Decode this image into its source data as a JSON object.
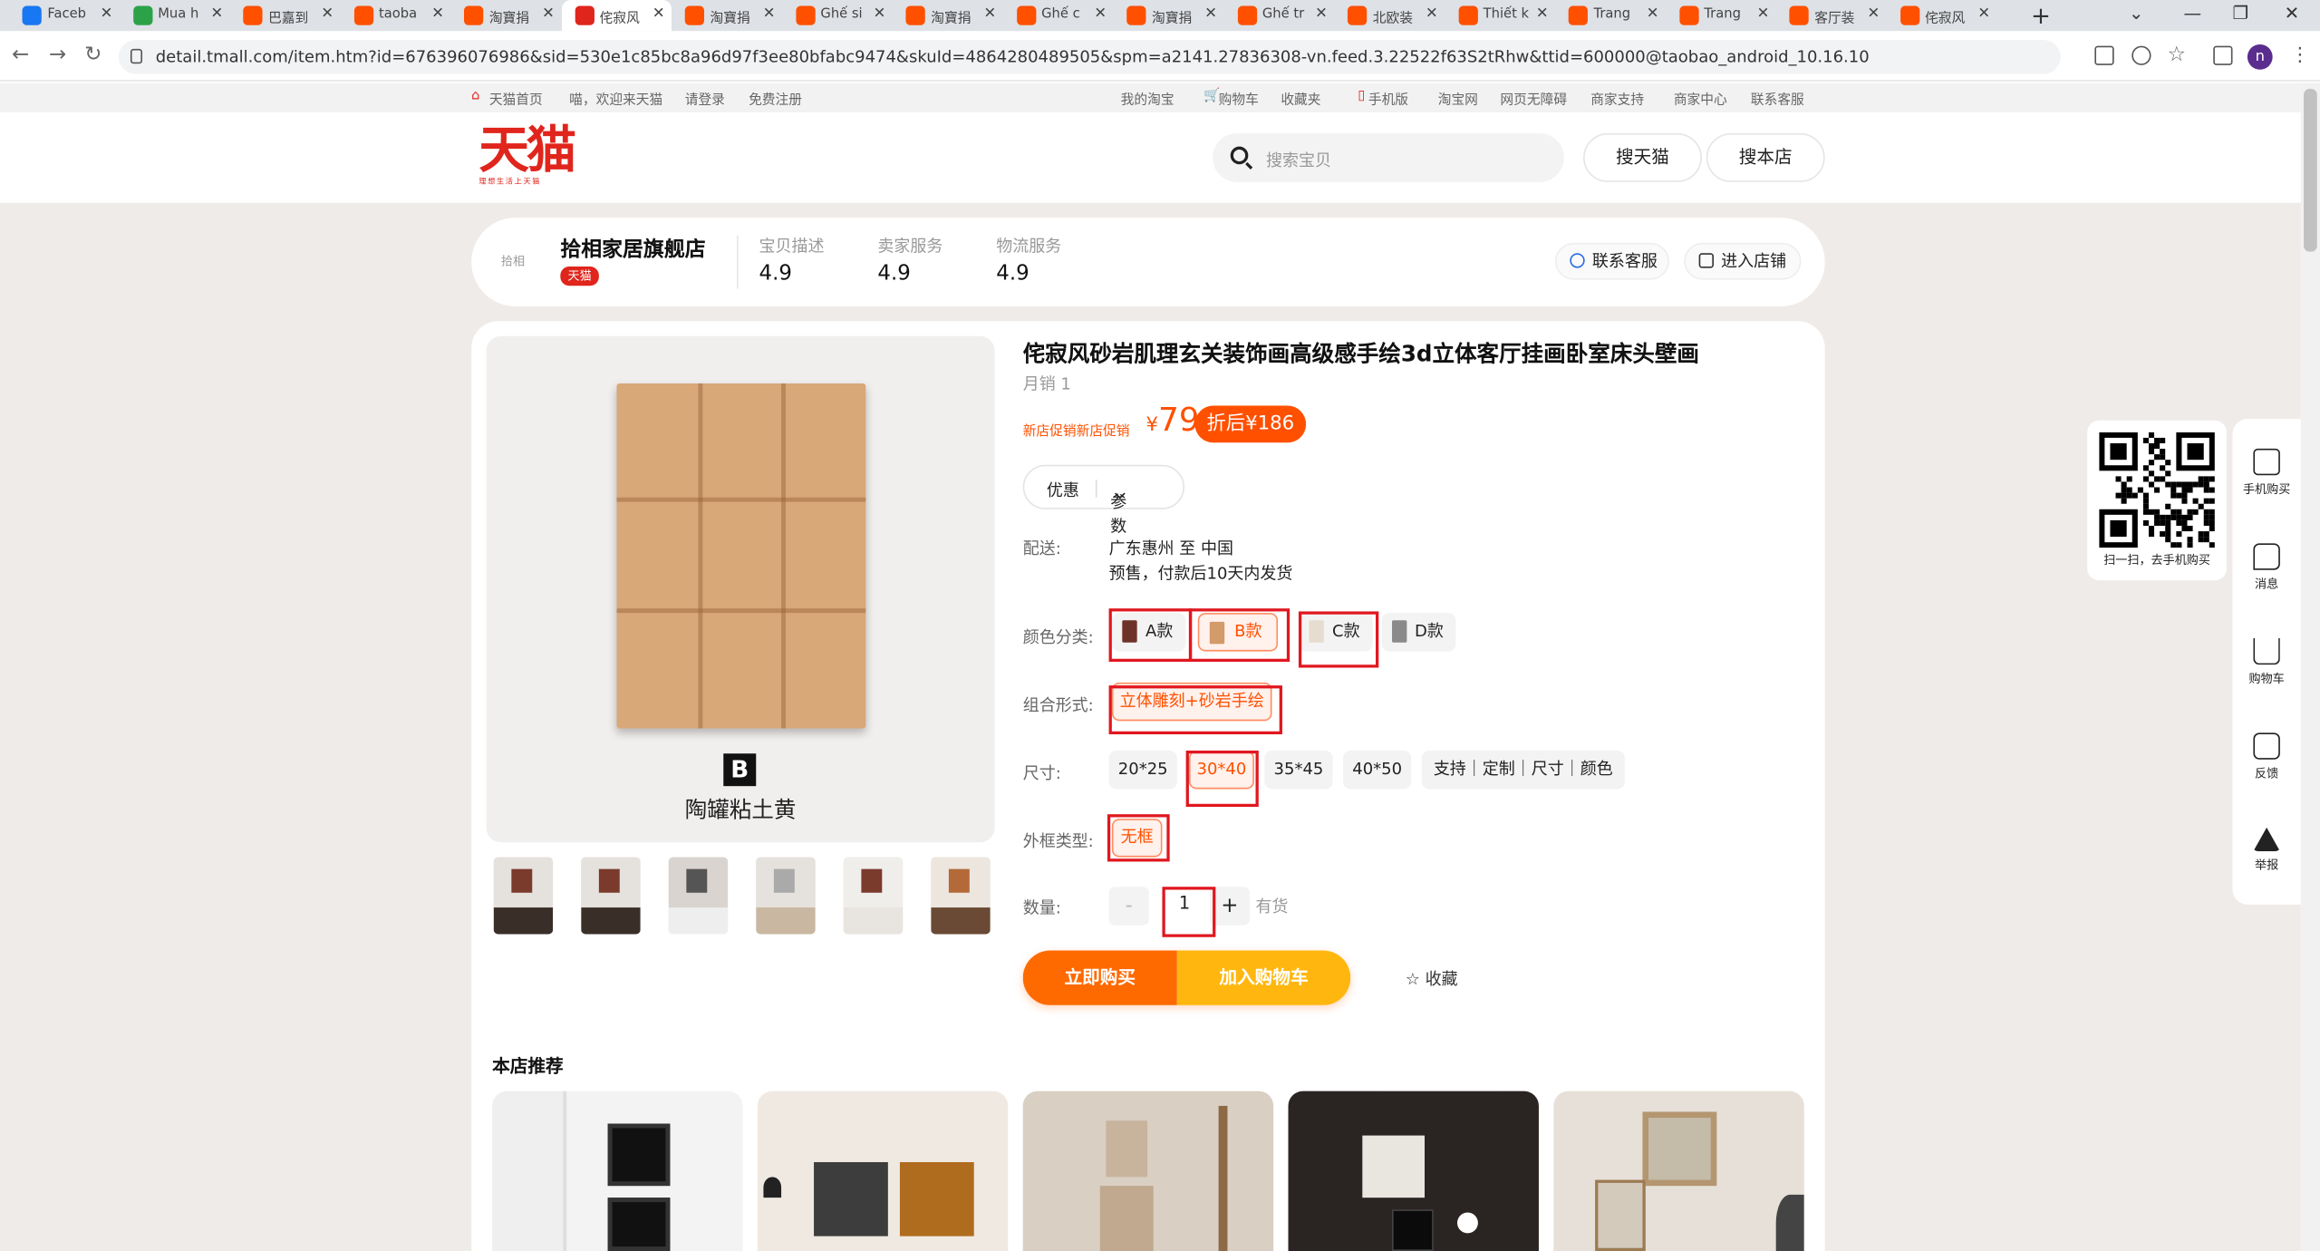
{
  "browser": {
    "tabs": [
      {
        "label": "Faceb",
        "icon": "facebook-icon",
        "color": "#1877f2"
      },
      {
        "label": "Mua h",
        "icon": "shop-icon",
        "color": "#2ba248"
      },
      {
        "label": "巴嘉到",
        "icon": "taobao-icon",
        "color": "#ff5000"
      },
      {
        "label": "taoba",
        "icon": "taobao-icon",
        "color": "#ff5000"
      },
      {
        "label": "淘寶捐",
        "icon": "taobao-icon",
        "color": "#ff5000"
      },
      {
        "label": "侘寂风",
        "icon": "tmall-icon",
        "color": "#e0251c"
      },
      {
        "label": "淘寶捐",
        "icon": "taobao-icon",
        "color": "#ff5000"
      },
      {
        "label": "Ghế si",
        "icon": "taobao-icon",
        "color": "#ff5000"
      },
      {
        "label": "淘寶捐",
        "icon": "taobao-icon",
        "color": "#ff5000"
      },
      {
        "label": "Ghế c",
        "icon": "taobao-icon",
        "color": "#ff5000"
      },
      {
        "label": "淘寶捐",
        "icon": "taobao-icon",
        "color": "#ff5000"
      },
      {
        "label": "Ghế tr",
        "icon": "taobao-icon",
        "color": "#ff5000"
      },
      {
        "label": "北欧装",
        "icon": "taobao-icon",
        "color": "#ff5000"
      },
      {
        "label": "Thiết k",
        "icon": "taobao-icon",
        "color": "#ff5000"
      },
      {
        "label": "Trang",
        "icon": "taobao-icon",
        "color": "#ff5000"
      },
      {
        "label": "Trang",
        "icon": "taobao-icon",
        "color": "#ff5000"
      },
      {
        "label": "客厅装",
        "icon": "taobao-icon",
        "color": "#ff5000"
      },
      {
        "label": "侘寂风",
        "icon": "taobao-icon",
        "color": "#ff5000"
      }
    ],
    "new_tab": "+",
    "url": "detail.tmall.com/item.htm?id=676396076986&sid=530e1c85bc8a96d97f3ee80bfabc9474&skuId=4864280489505&spm=a2141.27836308-vn.feed.3.22522f63S2tRhw&ttid=600000@taobao_android_10.16.10",
    "profile_initial": "n"
  },
  "sitebar": {
    "home": "天猫首页",
    "greeting": "喵，欢迎来天猫",
    "login": "请登录",
    "register": "免费注册",
    "links": [
      "我的淘宝",
      "购物车",
      "收藏夹",
      "手机版",
      "淘宝网",
      "网页无障碍",
      "商家支持",
      "商家中心",
      "联系客服"
    ]
  },
  "header": {
    "logo": "天猫",
    "logo_sub": "理想生活上天猫",
    "search_placeholder": "搜索宝贝",
    "search_tmall": "搜天猫",
    "search_store": "搜本店"
  },
  "shop": {
    "logo_text": "拾相",
    "name": "拾相家居旗舰店",
    "tag": "天猫",
    "metrics": [
      {
        "label": "宝贝描述",
        "value": "4.9"
      },
      {
        "label": "卖家服务",
        "value": "4.9"
      },
      {
        "label": "物流服务",
        "value": "4.9"
      }
    ],
    "contact": "联系客服",
    "enter": "进入店铺"
  },
  "product": {
    "title": "侘寂风砂岩肌理玄关装饰画高级感手绘3d立体客厅挂画卧室床头壁画",
    "sales": "月销 1",
    "promo_label": "新店促销新店促销",
    "currency": "¥",
    "price": "79",
    "discount": "折后¥186",
    "tab_discount": "优惠",
    "tab_params": "参数",
    "image_badge": "B",
    "image_caption": "陶罐粘土黄",
    "ship_label": "配送:",
    "ship_route": "广东惠州 至 中国",
    "ship_note": "预售，付款后10天内发货",
    "color_label": "颜色分类:",
    "colors": [
      {
        "label": "A款",
        "swatch": "#6e3328"
      },
      {
        "label": "B款",
        "swatch": "#d39a6a"
      },
      {
        "label": "C款",
        "swatch": "#e6dccf"
      },
      {
        "label": "D款",
        "swatch": "#8a8a8a"
      }
    ],
    "combo_label": "组合形式:",
    "combo": "立体雕刻+砂岩手绘",
    "size_label": "尺寸:",
    "sizes": [
      "20*25",
      "30*40",
      "35*45",
      "40*50",
      "支持｜定制｜尺寸｜颜色"
    ],
    "frame_label": "外框类型:",
    "frame": "无框",
    "qty_label": "数量:",
    "qty_minus": "-",
    "qty": "1",
    "qty_plus": "+",
    "stock": "有货",
    "buy_now": "立即购买",
    "add_cart": "加入购物车",
    "favorite": "☆ 收藏"
  },
  "recommend": {
    "title": "本店推荐"
  },
  "floating": {
    "qr_caption": "扫一扫，去手机购买",
    "items": [
      "手机购买",
      "消息",
      "购物车",
      "反馈",
      "举报"
    ]
  },
  "colors": {
    "accent": "#ff5000",
    "tmall_red": "#e0251c",
    "annotation_red": "#e0171f"
  }
}
